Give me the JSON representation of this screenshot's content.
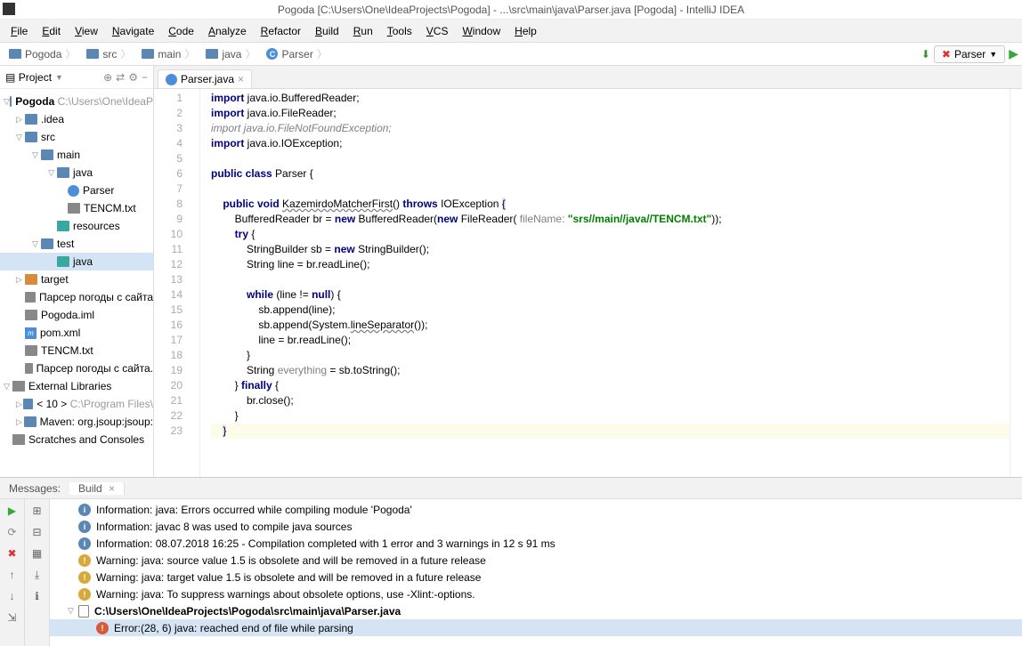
{
  "title": "Pogoda [C:\\Users\\One\\IdeaProjects\\Pogoda] - ...\\src\\main\\java\\Parser.java [Pogoda] - IntelliJ IDEA",
  "menu": [
    "File",
    "Edit",
    "View",
    "Navigate",
    "Code",
    "Analyze",
    "Refactor",
    "Build",
    "Run",
    "Tools",
    "VCS",
    "Window",
    "Help"
  ],
  "breadcrumbs": [
    "Pogoda",
    "src",
    "main",
    "java",
    "Parser"
  ],
  "run_config": "Parser",
  "project_label": "Project",
  "tree": {
    "root": "Pogoda",
    "root_path": "C:\\Users\\One\\IdeaP",
    "idea": ".idea",
    "src": "src",
    "main": "main",
    "java1": "java",
    "parser": "Parser",
    "tencm": "TENCM.txt",
    "resources": "resources",
    "test": "test",
    "java2": "java",
    "target": "target",
    "parser_doc": "Парсер погоды с сайта",
    "pogoda_iml": "Pogoda.iml",
    "pom": "pom.xml",
    "tencm2": "TENCM.txt",
    "parser_doc2": "Парсер погоды с сайта.",
    "ext_lib": "External Libraries",
    "jdk": "< 10 >",
    "jdk_path": "C:\\Program Files\\",
    "maven": "Maven: org.jsoup:jsoup:",
    "scratches": "Scratches and Consoles"
  },
  "tab": "Parser.java",
  "code_lines": [
    {
      "n": 1,
      "html": "<span class='kw'>import</span> java.io.BufferedReader;"
    },
    {
      "n": 2,
      "html": "<span class='kw'>import</span> java.io.FileReader;"
    },
    {
      "n": 3,
      "html": "<span class='cm'>import java.io.FileNotFoundException;</span>"
    },
    {
      "n": 4,
      "html": "<span class='kw'>import</span> java.io.IOException;"
    },
    {
      "n": 5,
      "html": ""
    },
    {
      "n": 6,
      "html": "<span class='kw'>public class</span> Parser {"
    },
    {
      "n": 7,
      "html": ""
    },
    {
      "n": 8,
      "html": "    <span class='kw'>public void</span> <span class='underline'>KazemirdoMatcherFirst</span>() <span class='kw'>throws</span> IOException <span class='hl'>{</span>"
    },
    {
      "n": 9,
      "html": "        BufferedReader br = <span class='kw'>new</span> BufferedReader(<span class='kw'>new</span> FileReader( <span class='param'>fileName:</span> <span class='str'>\"srs//main//java//TENCM.txt\"</span>));"
    },
    {
      "n": 10,
      "html": "        <span class='kw'>try</span> {"
    },
    {
      "n": 11,
      "html": "            StringBuilder sb = <span class='kw'>new</span> StringBuilder();"
    },
    {
      "n": 12,
      "html": "            String line = br.readLine();"
    },
    {
      "n": 13,
      "html": ""
    },
    {
      "n": 14,
      "html": "            <span class='kw'>while</span> (line != <span class='kw'>null</span>) {"
    },
    {
      "n": 15,
      "html": "                sb.append(line);"
    },
    {
      "n": 16,
      "html": "                sb.append(System.<span class='underline'>lineSeparator</span>());"
    },
    {
      "n": 17,
      "html": "                line = br.readLine();"
    },
    {
      "n": 18,
      "html": "            }"
    },
    {
      "n": 19,
      "html": "            String <span class='param'>everything</span> = sb.toString();"
    },
    {
      "n": 20,
      "html": "        } <span class='kw'>finally</span> {"
    },
    {
      "n": 21,
      "html": "            br.close();"
    },
    {
      "n": 22,
      "html": "        }"
    },
    {
      "n": 23,
      "html": "    <span class='hl'>}</span>",
      "caret": true
    }
  ],
  "messages_label": "Messages:",
  "build_label": "Build",
  "messages": [
    {
      "type": "info",
      "text": "Information: java: Errors occurred while compiling module 'Pogoda'"
    },
    {
      "type": "info",
      "text": "Information: javac 8 was used to compile java sources"
    },
    {
      "type": "info",
      "text": "Information: 08.07.2018 16:25 - Compilation completed with 1 error and 3 warnings in 12 s 91 ms"
    },
    {
      "type": "warn",
      "text": "Warning: java: source value 1.5 is obsolete and will be removed in a future release"
    },
    {
      "type": "warn",
      "text": "Warning: java: target value 1.5 is obsolete and will be removed in a future release"
    },
    {
      "type": "warn",
      "text": "Warning: java: To suppress warnings about obsolete options, use -Xlint:-options."
    },
    {
      "type": "file",
      "text": "C:\\Users\\One\\IdeaProjects\\Pogoda\\src\\main\\java\\Parser.java",
      "arrow": true,
      "bold": true
    },
    {
      "type": "err",
      "text": "Error:(28, 6) java: reached end of file while parsing",
      "sel": true,
      "indent": true
    }
  ]
}
